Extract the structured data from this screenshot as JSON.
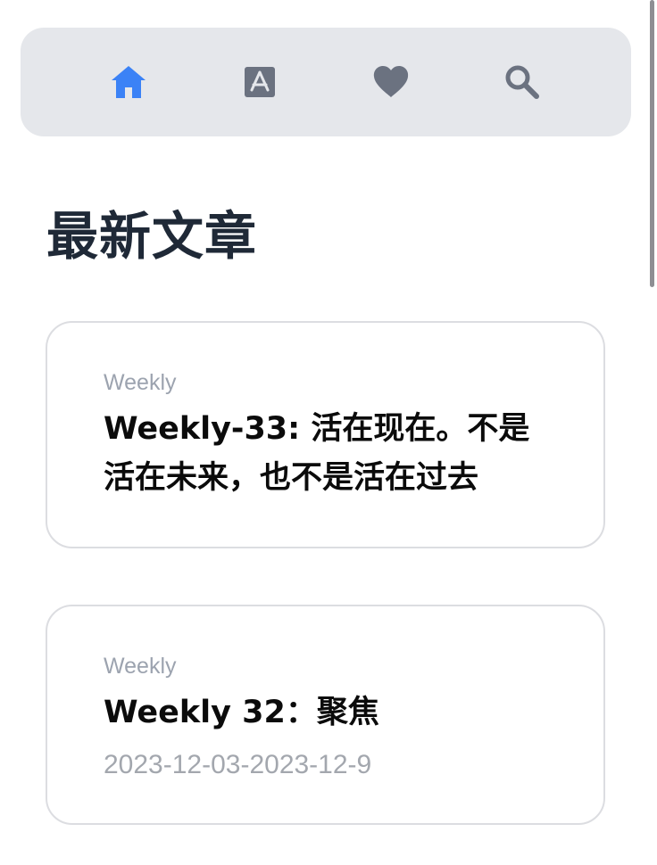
{
  "nav": {
    "items": [
      {
        "icon": "home-icon",
        "active": true,
        "color": "#3b82f6"
      },
      {
        "icon": "app-store-icon",
        "active": false,
        "color": "#6b7280"
      },
      {
        "icon": "heart-icon",
        "active": false,
        "color": "#6b7280"
      },
      {
        "icon": "search-icon",
        "active": false,
        "color": "#6b7280"
      }
    ],
    "background": "#e5e7eb"
  },
  "main": {
    "section_title": "最新文章",
    "articles": [
      {
        "category": "Weekly",
        "title": "Weekly-33: 活在现在。不是活在未来，也不是活在过去",
        "date": ""
      },
      {
        "category": "Weekly",
        "title": "Weekly 32：聚焦",
        "date": "2023-12-03-2023-12-9"
      }
    ]
  },
  "colors": {
    "accent": "#3b82f6",
    "icon_inactive": "#6b7280",
    "muted_text": "#9ca3af",
    "card_border": "#dcdde1"
  }
}
